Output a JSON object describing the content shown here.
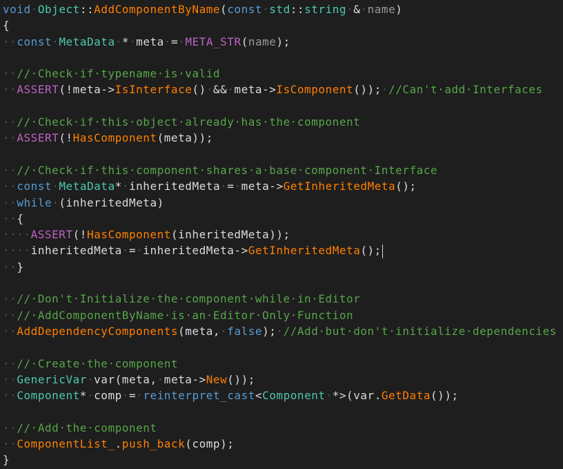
{
  "editor": {
    "colors": {
      "background": "#1e1e1e",
      "keyword": "#569cd6",
      "type": "#4ec9b0",
      "function": "#ff8000",
      "macro": "#bd63c5",
      "comment": "#57a64a",
      "text": "#dcdcdc",
      "whitespace_marker": "#3c5a6a"
    },
    "caret_line": 15,
    "lines": [
      [
        [
          "kw",
          "void"
        ],
        [
          "ws",
          "·"
        ],
        [
          "ty",
          "Object"
        ],
        [
          "tx",
          "::"
        ],
        [
          "fn",
          "AddComponentByName"
        ],
        [
          "tx",
          "("
        ],
        [
          "kw",
          "const"
        ],
        [
          "ws",
          "·"
        ],
        [
          "ty",
          "std"
        ],
        [
          "tx",
          "::"
        ],
        [
          "ty",
          "string"
        ],
        [
          "ws",
          "·"
        ],
        [
          "tx",
          "&"
        ],
        [
          "ws",
          "·"
        ],
        [
          "pa",
          "name"
        ],
        [
          "tx",
          ")"
        ]
      ],
      [
        [
          "tx",
          "{"
        ]
      ],
      [
        [
          "ws",
          "··"
        ],
        [
          "kw",
          "const"
        ],
        [
          "ws",
          "·"
        ],
        [
          "ty",
          "MetaData"
        ],
        [
          "ws",
          "·"
        ],
        [
          "tx",
          "*"
        ],
        [
          "ws",
          "·"
        ],
        [
          "tx",
          "meta"
        ],
        [
          "ws",
          "·"
        ],
        [
          "tx",
          "="
        ],
        [
          "ws",
          "·"
        ],
        [
          "mac",
          "META_STR"
        ],
        [
          "tx",
          "("
        ],
        [
          "pa",
          "name"
        ],
        [
          "tx",
          ");"
        ]
      ],
      [],
      [
        [
          "ws",
          "··"
        ],
        [
          "cm",
          "//·Check·if·typename·is·valid"
        ]
      ],
      [
        [
          "ws",
          "··"
        ],
        [
          "mac",
          "ASSERT"
        ],
        [
          "tx",
          "(!meta->"
        ],
        [
          "fn",
          "IsInterface"
        ],
        [
          "tx",
          "()"
        ],
        [
          "ws",
          "·"
        ],
        [
          "tx",
          "&&"
        ],
        [
          "ws",
          "·"
        ],
        [
          "tx",
          "meta->"
        ],
        [
          "fn",
          "IsComponent"
        ],
        [
          "tx",
          "());"
        ],
        [
          "ws",
          "·"
        ],
        [
          "cm",
          "//Can't·add·Interfaces"
        ]
      ],
      [],
      [
        [
          "ws",
          "··"
        ],
        [
          "cm",
          "//·Check·if·this·object·already·has·the·component"
        ]
      ],
      [
        [
          "ws",
          "··"
        ],
        [
          "mac",
          "ASSERT"
        ],
        [
          "tx",
          "(!"
        ],
        [
          "fn",
          "HasComponent"
        ],
        [
          "tx",
          "(meta));"
        ]
      ],
      [],
      [
        [
          "ws",
          "··"
        ],
        [
          "cm",
          "//·Check·if·this·component·shares·a·base·component·Interface"
        ]
      ],
      [
        [
          "ws",
          "··"
        ],
        [
          "kw",
          "const"
        ],
        [
          "ws",
          "·"
        ],
        [
          "ty",
          "MetaData"
        ],
        [
          "tx",
          "*"
        ],
        [
          "ws",
          "·"
        ],
        [
          "tx",
          "inheritedMeta"
        ],
        [
          "ws",
          "·"
        ],
        [
          "tx",
          "="
        ],
        [
          "ws",
          "·"
        ],
        [
          "tx",
          "meta->"
        ],
        [
          "fn",
          "GetInheritedMeta"
        ],
        [
          "tx",
          "();"
        ]
      ],
      [
        [
          "ws",
          "··"
        ],
        [
          "kw",
          "while"
        ],
        [
          "ws",
          "·"
        ],
        [
          "tx",
          "(inheritedMeta)"
        ]
      ],
      [
        [
          "ws",
          "··"
        ],
        [
          "tx",
          "{"
        ]
      ],
      [
        [
          "ws",
          "····"
        ],
        [
          "mac",
          "ASSERT"
        ],
        [
          "tx",
          "(!"
        ],
        [
          "fn",
          "HasComponent"
        ],
        [
          "tx",
          "(inheritedMeta));"
        ]
      ],
      [
        [
          "ws",
          "····"
        ],
        [
          "tx",
          "inheritedMeta"
        ],
        [
          "ws",
          "·"
        ],
        [
          "tx",
          "="
        ],
        [
          "ws",
          "·"
        ],
        [
          "tx",
          "inheritedMeta->"
        ],
        [
          "fn",
          "GetInheritedMeta"
        ],
        [
          "tx",
          "();"
        ]
      ],
      [
        [
          "ws",
          "··"
        ],
        [
          "tx",
          "}"
        ]
      ],
      [],
      [
        [
          "ws",
          "··"
        ],
        [
          "cm",
          "//·Don't·Initialize·the·component·while·in·Editor"
        ]
      ],
      [
        [
          "ws",
          "··"
        ],
        [
          "cm",
          "//·AddComponentByName·is·an·Editor·Only·Function"
        ]
      ],
      [
        [
          "ws",
          "··"
        ],
        [
          "fn",
          "AddDependencyComponents"
        ],
        [
          "tx",
          "(meta,"
        ],
        [
          "ws",
          "·"
        ],
        [
          "kw",
          "false"
        ],
        [
          "tx",
          ");"
        ],
        [
          "ws",
          "·"
        ],
        [
          "cm",
          "//Add·but·don't·initialize·dependencies"
        ]
      ],
      [],
      [
        [
          "ws",
          "··"
        ],
        [
          "cm",
          "//·Create·the·component"
        ]
      ],
      [
        [
          "ws",
          "··"
        ],
        [
          "ty",
          "GenericVar"
        ],
        [
          "ws",
          "·"
        ],
        [
          "tx",
          "var(meta,"
        ],
        [
          "ws",
          "·"
        ],
        [
          "tx",
          "meta->"
        ],
        [
          "fn",
          "New"
        ],
        [
          "tx",
          "());"
        ]
      ],
      [
        [
          "ws",
          "··"
        ],
        [
          "ty",
          "Component"
        ],
        [
          "tx",
          "*"
        ],
        [
          "ws",
          "·"
        ],
        [
          "tx",
          "comp"
        ],
        [
          "ws",
          "·"
        ],
        [
          "tx",
          "="
        ],
        [
          "ws",
          "·"
        ],
        [
          "kw",
          "reinterpret_cast"
        ],
        [
          "tx",
          "<"
        ],
        [
          "ty",
          "Component"
        ],
        [
          "ws",
          "·"
        ],
        [
          "tx",
          "*>(var."
        ],
        [
          "fn",
          "GetData"
        ],
        [
          "tx",
          "());"
        ]
      ],
      [],
      [
        [
          "ws",
          "··"
        ],
        [
          "cm",
          "//·Add·the·component"
        ]
      ],
      [
        [
          "ws",
          "··"
        ],
        [
          "fn",
          "ComponentList_"
        ],
        [
          "tx",
          "."
        ],
        [
          "fn",
          "push_back"
        ],
        [
          "tx",
          "(comp);"
        ]
      ],
      [
        [
          "tx",
          "}"
        ]
      ]
    ]
  }
}
